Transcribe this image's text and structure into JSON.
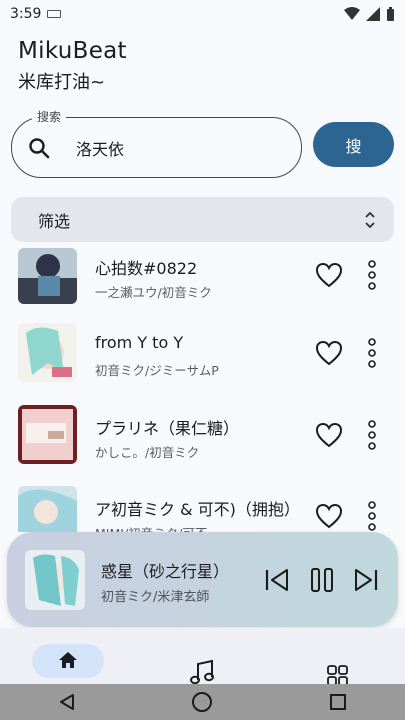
{
  "status_bar": {
    "time": "3:59"
  },
  "app": {
    "title": "MikuBeat",
    "subtitle": "米库打油~"
  },
  "search": {
    "label": "搜索",
    "value": "洛天依",
    "button": "搜"
  },
  "filter": {
    "label": "筛选"
  },
  "songs": [
    {
      "title": "心拍数#0822",
      "artist": "一之瀬ユウ/初音ミク"
    },
    {
      "title": "from Y to Y",
      "artist": "初音ミク/ジミーサムP"
    },
    {
      "title": "プラリネ（果仁糖）",
      "artist": "かしこ。/初音ミク"
    },
    {
      "title": "ア初音ミク & 可不)（拥抱）",
      "artist": "MIMI/初音ミク/可不"
    }
  ],
  "player": {
    "title": "惑星（砂之行星）",
    "artist": "初音ミク/米津玄師"
  },
  "bottom_nav": {
    "items": [
      {
        "label": "首页"
      },
      {
        "label": ""
      },
      {
        "label": ""
      }
    ]
  },
  "colors": {
    "accent": "#2d6592",
    "nav_pill": "#d4e3f7",
    "filter_bg": "#e4e6ec"
  }
}
